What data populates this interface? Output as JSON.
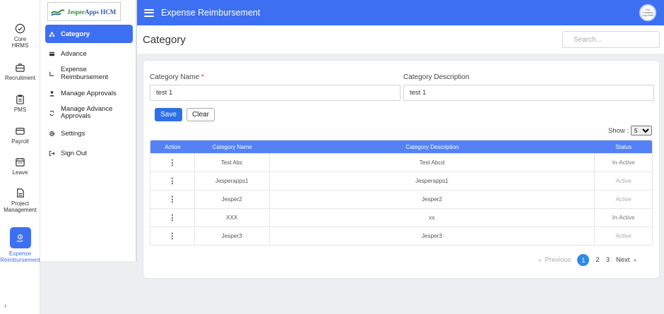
{
  "logo": {
    "part1": "Jesper",
    "part2": "Apps HCM"
  },
  "rail": [
    {
      "label": "Core HRMS",
      "icon": "shield-check-icon"
    },
    {
      "label": "Recruitment",
      "icon": "briefcase-icon"
    },
    {
      "label": "PMS",
      "icon": "clipboard-icon"
    },
    {
      "label": "Payroll",
      "icon": "wallet-icon"
    },
    {
      "label": "Leave",
      "icon": "calendar-icon"
    },
    {
      "label": "Project Management",
      "icon": "document-icon"
    },
    {
      "label": "Expense Reimbursement",
      "icon": "hand-coin-icon"
    }
  ],
  "rail_bottom": "›",
  "submenu": [
    {
      "label": "Category",
      "icon": "triangle-shapes-icon"
    },
    {
      "label": "Advance",
      "icon": "card-icon"
    },
    {
      "label": "Expense Reimbursement",
      "icon": "expense-icon"
    },
    {
      "label": "Manage Approvals",
      "icon": "user-icon"
    },
    {
      "label": "Manage Advance Approvals",
      "icon": "refresh-icon"
    },
    {
      "label": "Settings",
      "icon": "gear-icon"
    },
    {
      "label": "Sign Out",
      "icon": "sign-out-icon"
    }
  ],
  "topbar": {
    "title": "Expense Reimbursement",
    "avatar_text": "Your Company Logo Here"
  },
  "page": {
    "title": "Category",
    "search_placeholder": "Search..."
  },
  "form": {
    "name_label": "Category Name",
    "name_required": "*",
    "name_value": "test 1",
    "desc_label": "Category Description",
    "desc_value": "test 1",
    "save_label": "Save",
    "clear_label": "Clear"
  },
  "show": {
    "label": "Show :",
    "value": "5"
  },
  "table": {
    "headers": [
      "Action",
      "Category Name",
      "Category Description",
      "Status"
    ],
    "rows": [
      {
        "action": "⋮",
        "name": "Test Abc",
        "description": "Test Abcd",
        "status": "In-Active"
      },
      {
        "action": "⋮",
        "name": "Jesperapps1",
        "description": "Jesperapps1",
        "status": "Active"
      },
      {
        "action": "⋮",
        "name": "Jesper2",
        "description": "Jesper2",
        "status": "Active"
      },
      {
        "action": "⋮",
        "name": "XXX",
        "description": "xx",
        "status": "In-Active"
      },
      {
        "action": "⋮",
        "name": "Jesper3",
        "description": "Jesper3",
        "status": "Active"
      }
    ]
  },
  "pagination": {
    "prev_arrow": "«",
    "prev": "Previous",
    "pages": [
      "1",
      "2",
      "3"
    ],
    "next": "Next",
    "next_arrow": "»"
  },
  "colors": {
    "primary": "#3d6ff2",
    "table_header": "#5482f5",
    "page_active": "#2e8ae8"
  }
}
